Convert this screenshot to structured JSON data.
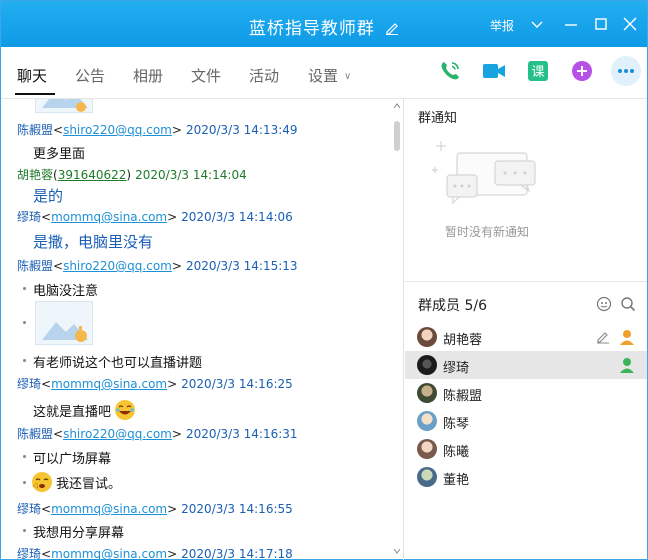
{
  "window": {
    "title": "蓝桥指导教师群",
    "report": "举报"
  },
  "tabs": [
    {
      "label": "聊天"
    },
    {
      "label": "公告"
    },
    {
      "label": "相册"
    },
    {
      "label": "文件"
    },
    {
      "label": "活动"
    },
    {
      "label": "设置"
    }
  ],
  "chat": {
    "messages": [
      {
        "name": "陈赮盟",
        "email": "shiro220@qq.com",
        "time": "2020/3/3 14:13:49",
        "text": "更多里面"
      },
      {
        "name": "胡艳蓉",
        "qq": "391640622",
        "time": "2020/3/3 14:14:04",
        "text": "是的"
      },
      {
        "name": "缪琦",
        "email": "mommq@sina.com",
        "time": "2020/3/3 14:14:06",
        "text": "是撒，电脑里没有"
      },
      {
        "name": "陈赮盟",
        "email": "shiro220@qq.com",
        "time": "2020/3/3 14:15:13",
        "text": "电脑没注意",
        "text2": "有老师说这个也可以直播讲题"
      },
      {
        "name": "缪琦",
        "email": "mommq@sina.com",
        "time": "2020/3/3 14:16:25",
        "text": "这就是直播吧"
      },
      {
        "name": "陈赮盟",
        "email": "shiro220@qq.com",
        "time": "2020/3/3 14:16:31",
        "text": "可以广场屏幕",
        "text2": "我还冒试。"
      },
      {
        "name": "缪琦",
        "email": "mommq@sina.com",
        "time": "2020/3/3 14:16:55",
        "text": "我想用分享屏幕"
      },
      {
        "name": "缪琦",
        "email": "mommq@sina.com",
        "time": "2020/3/3 14:17:18",
        "text": ""
      }
    ]
  },
  "notice": {
    "title": "群通知",
    "empty_text": "暂时没有新通知"
  },
  "members": {
    "title": "群成员 5/6",
    "list": [
      {
        "name": "胡艳蓉"
      },
      {
        "name": "缪琦"
      },
      {
        "name": "陈赮盟"
      },
      {
        "name": "陈琴"
      },
      {
        "name": "陈曦"
      },
      {
        "name": "董艳"
      }
    ]
  },
  "colors": {
    "titlebar": "#1aa5ee",
    "link": "#1e90d6",
    "name_blue": "#1a5fb4",
    "name_green": "#1f7a2a"
  }
}
